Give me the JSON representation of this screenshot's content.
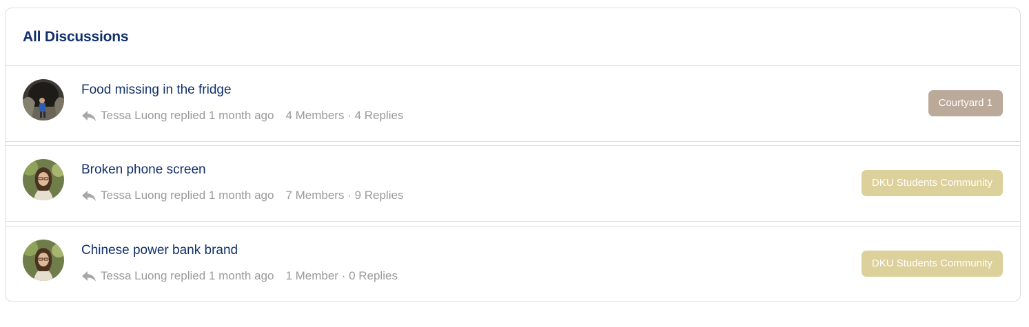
{
  "header": {
    "title": "All Discussions"
  },
  "discussions": [
    {
      "title": "Food missing in the fridge",
      "author": "Tessa Luong",
      "activity": "replied",
      "time": "1 month ago",
      "stats": "4 Members · 4 Replies",
      "group": "Courtyard 1",
      "group_color": "#bba99a",
      "avatar": "cave-photo"
    },
    {
      "title": "Broken phone screen",
      "author": "Tessa Luong",
      "activity": "replied",
      "time": "1 month ago",
      "stats": "7 Members · 9 Replies",
      "group": "DKU Students Community",
      "group_color": "#dcd09b",
      "avatar": "portrait-photo"
    },
    {
      "title": "Chinese power bank brand",
      "author": "Tessa Luong",
      "activity": "replied",
      "time": "1 month ago",
      "stats": "1 Member · 0 Replies",
      "group": "DKU Students Community",
      "group_color": "#dcd09b",
      "avatar": "portrait-photo"
    }
  ]
}
